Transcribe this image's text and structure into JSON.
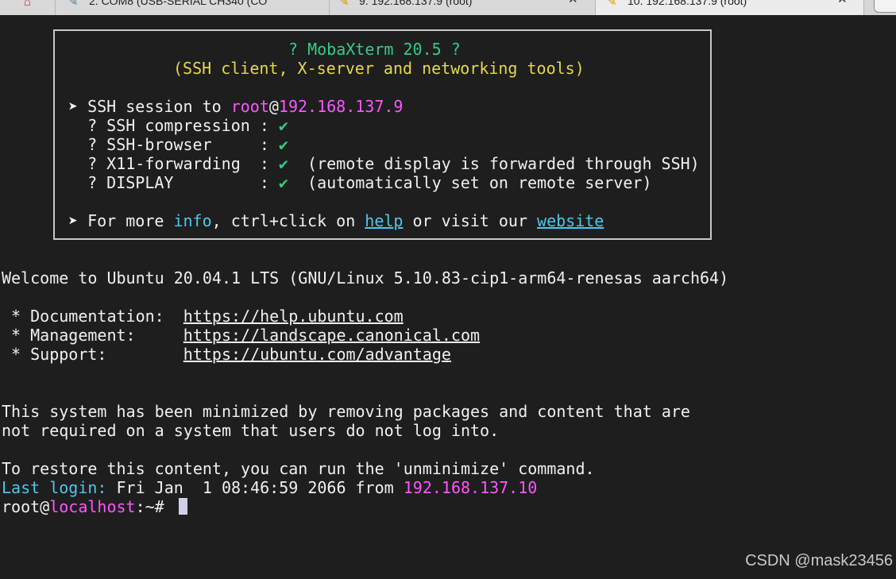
{
  "tabs": [
    {
      "label": "",
      "icon": "home-icon"
    },
    {
      "label": "2. COM8  (USB-SERIAL CH340 (CO",
      "icon": "serial-icon",
      "close": ""
    },
    {
      "label": "9. 192.168.137.9 (root)",
      "icon": "ssh-icon",
      "close": "✕"
    },
    {
      "label": "10. 192.168.137.9 (root)",
      "icon": "ssh-icon",
      "close": "✕"
    }
  ],
  "banner": {
    "title": "? MobaXterm 20.5 ?",
    "subtitle": "(SSH client, X-server and networking tools)",
    "session_prefix": "➤ SSH session to ",
    "session_user": "root",
    "session_at": "@",
    "session_host": "192.168.137.9",
    "features": [
      {
        "label": "  ? SSH compression : ",
        "check": "✔",
        "note": ""
      },
      {
        "label": "  ? SSH-browser     : ",
        "check": "✔",
        "note": ""
      },
      {
        "label": "  ? X11-forwarding  : ",
        "check": "✔",
        "note": "  (remote display is forwarded through SSH)"
      },
      {
        "label": "  ? DISPLAY         : ",
        "check": "✔",
        "note": "  (automatically set on remote server)"
      }
    ],
    "more_prefix": "➤ For more ",
    "more_info": "info",
    "more_mid": ", ctrl+click on ",
    "more_help": "help",
    "more_or": " or visit our ",
    "more_website": "website"
  },
  "motd": {
    "welcome": "Welcome to Ubuntu 20.04.1 LTS (GNU/Linux 5.10.83-cip1-arm64-renesas aarch64)",
    "links": [
      {
        "label": " * Documentation:  ",
        "url": "https://help.ubuntu.com"
      },
      {
        "label": " * Management:     ",
        "url": "https://landscape.canonical.com"
      },
      {
        "label": " * Support:        ",
        "url": "https://ubuntu.com/advantage"
      }
    ],
    "minimized_1": "This system has been minimized by removing packages and content that are",
    "minimized_2": "not required on a system that users do not log into.",
    "restore": "To restore this content, you can run the 'unminimize' command.",
    "last_login_label": "Last login:",
    "last_login_time": " Fri Jan  1 08:46:59 2066 from ",
    "last_login_ip": "192.168.137.10"
  },
  "prompt": {
    "user": "root",
    "at": "@",
    "host": "localhost",
    "path": ":~# "
  },
  "watermark": "CSDN @mask23456",
  "colors": {
    "background": "#1e1e1e",
    "green": "#32cd87",
    "yellow": "#e5d84a",
    "magenta": "#ff55ff",
    "cyan": "#4fc6ea"
  }
}
